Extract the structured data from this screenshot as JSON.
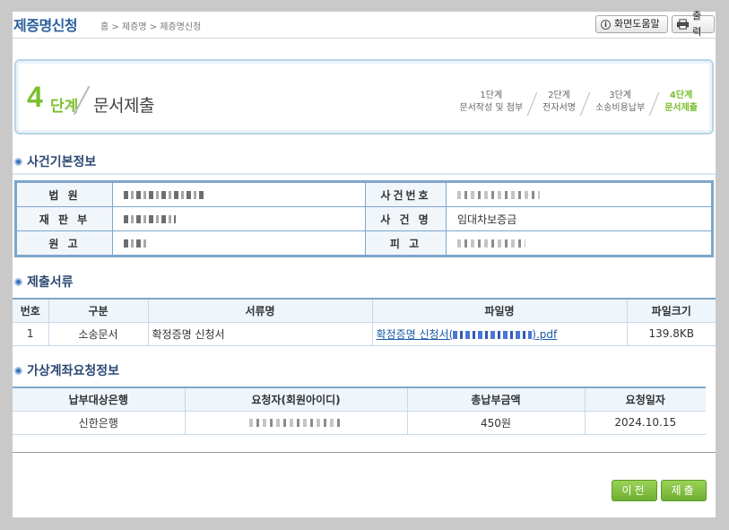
{
  "header": {
    "title": "제증명신청",
    "breadcrumb": "홈 > 제증명 > 제증명신청",
    "help_label": "화면도움말",
    "print_label": "출력"
  },
  "stepbar": {
    "number": "4",
    "word": "단계",
    "name": "문서제출",
    "steps": [
      {
        "step": "1단계",
        "name": "문서작성 및 첨부"
      },
      {
        "step": "2단계",
        "name": "전자서명"
      },
      {
        "step": "3단계",
        "name": "소송비용납부"
      },
      {
        "step": "4단계",
        "name": "문서제출"
      }
    ]
  },
  "case_info": {
    "title": "사건기본정보",
    "court_label": "법 원",
    "case_no_label": "사건번호",
    "division_label": "재 판 부",
    "case_name_label": "사 건 명",
    "case_name_value": "임대차보증금",
    "plaintiff_label": "원 고",
    "defendant_label": "피 고"
  },
  "documents": {
    "title": "제출서류",
    "columns": [
      "번호",
      "구분",
      "서류명",
      "파일명",
      "파일크기"
    ],
    "rows": [
      {
        "no": "1",
        "type": "소송문서",
        "doc_name": "확정증명 신청서",
        "file_prefix": "확정증명 신청서(",
        "file_suffix": ").pdf",
        "size": "139.8KB"
      }
    ]
  },
  "virtual_account": {
    "title": "가상계좌요청정보",
    "columns": [
      "납부대상은행",
      "요청자(회원아이디)",
      "총납부금액",
      "요청일자"
    ],
    "rows": [
      {
        "bank": "신한은행",
        "amount": "450원",
        "date": "2024.10.15"
      }
    ]
  },
  "buttons": {
    "prev": "이전",
    "submit": "제출"
  },
  "colors": {
    "accent_green": "#7cbf2f",
    "title_blue": "#2a5f9e",
    "border_blue": "#7ea6cc"
  }
}
